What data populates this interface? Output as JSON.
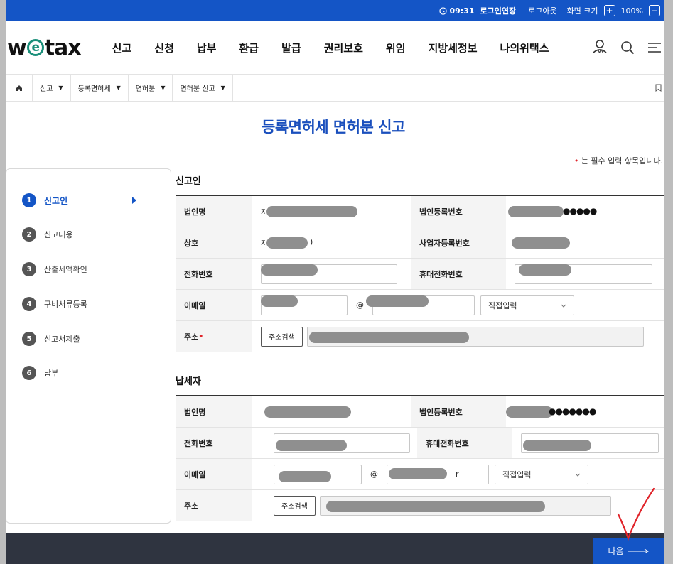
{
  "topbar": {
    "time": "09:31",
    "login_extend": "로그인연장",
    "logout": "로그아웃",
    "screen_size_label": "화면 크기",
    "zoom_plus": "+",
    "zoom_value": "100%",
    "zoom_minus": "−"
  },
  "header": {
    "logo_w": "w",
    "logo_e": "e",
    "logo_tax": "tax",
    "menu": [
      "신고",
      "신청",
      "납부",
      "환급",
      "발급",
      "권리보호",
      "위임",
      "지방세정보",
      "나의위택스"
    ],
    "my_badge": "MY"
  },
  "breadcrumb": {
    "items": [
      "신고",
      "등록면허세",
      "면허분",
      "면허분 신고"
    ]
  },
  "page": {
    "title": "등록면허세 면허분 신고",
    "required_note": "는 필수 입력 항목입니다."
  },
  "steps": [
    {
      "num": "1",
      "label": "신고인",
      "active": true
    },
    {
      "num": "2",
      "label": "신고내용"
    },
    {
      "num": "3",
      "label": "산출세액확인"
    },
    {
      "num": "4",
      "label": "구비서류등록"
    },
    {
      "num": "5",
      "label": "신고서제출"
    },
    {
      "num": "6",
      "label": "납부"
    }
  ],
  "reporter": {
    "title": "신고인",
    "corp_name_label": "법인명",
    "corp_name_prefix": "지",
    "corp_reg_label": "법인등록번호",
    "corp_reg_suffix": "●●●●●",
    "trade_name_label": "상호",
    "trade_name_prefix": "지",
    "trade_name_suffix": ")",
    "biz_reg_label": "사업자등록번호",
    "phone_label": "전화번호",
    "mobile_label": "휴대전화번호",
    "email_label": "이메일",
    "at": "@",
    "email_domain_select": "직접입력",
    "address_label": "주소",
    "address_search": "주소검색"
  },
  "taxpayer": {
    "title": "납세자",
    "corp_name_label": "법인명",
    "corp_reg_label": "법인등록번호",
    "corp_reg_suffix": "●●●●●●●",
    "phone_label": "전화번호",
    "mobile_label": "휴대전화번호",
    "email_label": "이메일",
    "at": "@",
    "email_domain_tail": "r",
    "email_domain_select": "직접입력",
    "address_label": "주소",
    "address_search": "주소검색"
  },
  "footer": {
    "next_label": "다음"
  },
  "colors": {
    "brand_blue": "#1455c6",
    "title_blue": "#1a4fbd",
    "required_red": "#e0242a",
    "annotation_red": "#e0242a"
  }
}
